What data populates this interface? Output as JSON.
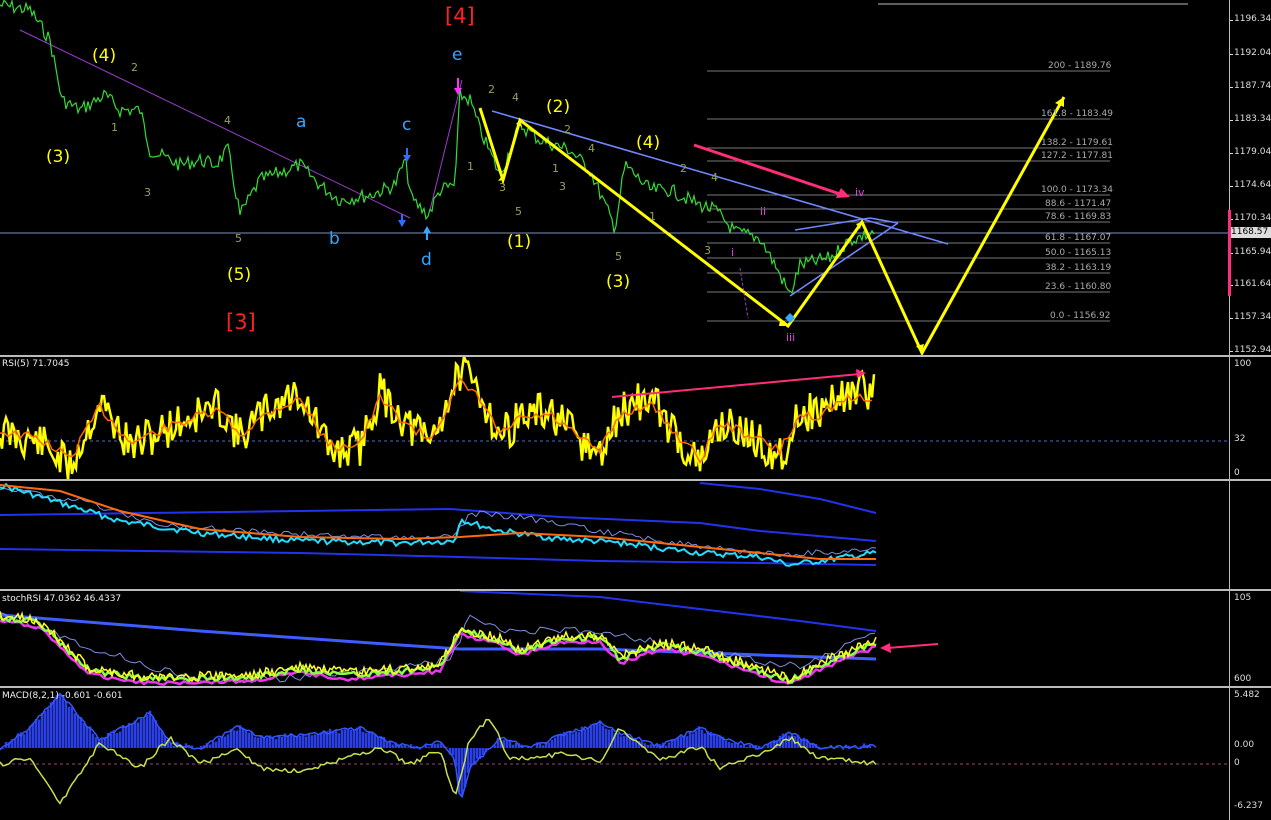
{
  "main": {
    "price_ticks": [
      "1196.34",
      "1192.04",
      "1187.74",
      "1183.34",
      "1179.04",
      "1174.64",
      "1170.34",
      "1165.94",
      "1161.64",
      "1157.34",
      "1152.94"
    ],
    "current_price": "1168.57",
    "fib_levels": [
      "200 - 1189.76",
      "161.8 - 1183.49",
      "138.2 - 1179.61",
      "127.2 - 1177.81",
      "100.0 - 1173.34",
      "88.6 - 1171.47",
      "78.6 - 1169.83",
      "61.8 - 1167.07",
      "50.0 - 1165.13",
      "38.2 - 1163.19",
      "23.6 - 1160.80",
      "0.0 - 1156.92"
    ],
    "wave_labels": {
      "y4a": "(4)",
      "y3a": "(3)",
      "y5a": "(5)",
      "r3": "[3]",
      "r4": "[4]",
      "ca": "a",
      "cb": "b",
      "cc": "c",
      "cd": "d",
      "ce": "e",
      "y1": "(1)",
      "y2": "(2)",
      "y3b": "(3)",
      "y4b": "(4)",
      "iii": "iii",
      "ii": "ii",
      "iv": "iv",
      "i": "i",
      "s2a": "2",
      "s1a": "1",
      "s3a": "3",
      "s4a": "4",
      "s5a": "5",
      "s2b": "2",
      "s4b": "4",
      "s1b": "1",
      "s3b": "3",
      "s5b": "5",
      "s2c": "2",
      "s1c": "1",
      "s3c": "3",
      "s4c": "4",
      "s5c": "5",
      "s2d": "2",
      "s1d": "1",
      "s3d": "3",
      "s4d": "4"
    }
  },
  "rsi": {
    "title": "RSI(5) 71.7045",
    "ticks": [
      "100",
      "32",
      "0"
    ]
  },
  "stoch": {
    "title": "stochRSI 47.0362 46.4337",
    "ticks": [
      "105",
      "600"
    ]
  },
  "macd": {
    "title": "MACD(8,2,1) -0.601 -0.601",
    "ticks": [
      "5.482",
      "0.00",
      "0",
      "-6.237"
    ]
  },
  "colors": {
    "price": "#33dd33",
    "yellow": "#ffff00",
    "pink": "#ff2d7a",
    "trend": "#6f86ff",
    "wave_blue": "#38a6ff",
    "red_label": "#ff2020",
    "rsi": "#ffff00",
    "rsi_ma": "#ff6a00"
  }
}
